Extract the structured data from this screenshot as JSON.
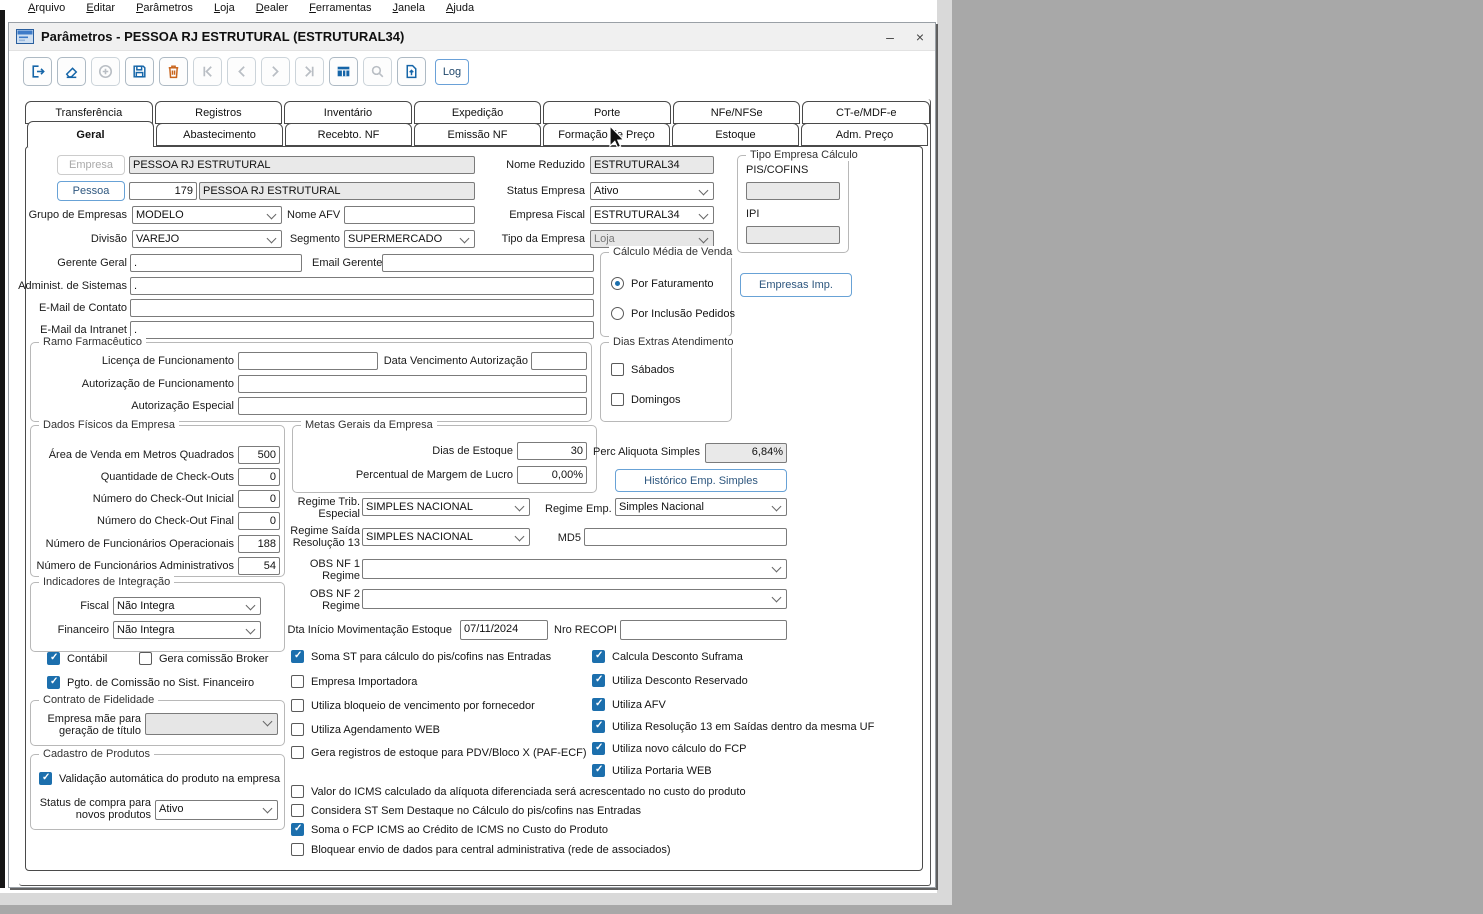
{
  "colors": {
    "accent_blue": "#1c6fad",
    "button_border_blue": "#68a2d6",
    "toolbar_icon_blue": "#1565a8",
    "trash_orange": "#c9651d",
    "desktop_gray": "#a8a8a8",
    "readonly_field_gray": "#e9e9e9"
  },
  "menu": {
    "items": [
      "Arquivo",
      "Editar",
      "Parâmetros",
      "Loja",
      "Dealer",
      "Ferramentas",
      "Janela",
      "Ajuda"
    ]
  },
  "window": {
    "title": "Parâmetros - PESSOA RJ ESTRUTURAL (ESTRUTURAL34)",
    "minimize": "–",
    "close": "×"
  },
  "toolbar": {
    "log": "Log"
  },
  "tabs": {
    "row1": [
      "Transferência",
      "Registros",
      "Inventário",
      "Expedição",
      "Porte",
      "NFe/NFSe",
      "CT-e/MDF-e"
    ],
    "row2": [
      "Geral",
      "Abastecimento",
      "Recebto. NF",
      "Emissão NF",
      "Formação de Preço",
      "Estoque",
      "Adm. Preço"
    ],
    "active": "Geral"
  },
  "form": {
    "empresa_btn": "Empresa",
    "empresa_value": "PESSOA RJ ESTRUTURAL",
    "nome_reduzido_label": "Nome Reduzido",
    "nome_reduzido_value": "ESTRUTURAL34",
    "pessoa_btn": "Pessoa",
    "pessoa_code": "179",
    "pessoa_value": "PESSOA RJ ESTRUTURAL",
    "status_label": "Status Empresa",
    "status_value": "Ativo",
    "grupo_label": "Grupo de Empresas",
    "grupo_value": "MODELO",
    "afv_label": "Nome AFV",
    "afv_value": "",
    "fiscal_label": "Empresa Fiscal",
    "fiscal_value": "ESTRUTURAL34",
    "divisao_label": "Divisão",
    "divisao_value": "VAREJO",
    "segmento_label": "Segmento",
    "segmento_value": "SUPERMERCADO",
    "tipo_label": "Tipo da Empresa",
    "tipo_value": "Loja",
    "calc_group": {
      "title": "Tipo Empresa Cálculo",
      "pis": "PIS/COFINS",
      "pis_value": "",
      "ipi": "IPI",
      "ipi_value": ""
    },
    "gerente_label": "Gerente Geral",
    "gerente_value": ".",
    "email_gerente_label": "Email Gerente",
    "email_gerente_value": "",
    "administ_label": "Administ. de Sistemas",
    "administ_value": ".",
    "email_contato_label": "E-Mail de Contato",
    "email_contato_value": "",
    "email_intranet_label": "E-Mail da Intranet",
    "email_intranet_value": ".",
    "media": {
      "title": "Cálculo Média de Venda",
      "opt1": "Por Faturamento",
      "opt1_selected": true,
      "opt2": "Por Inclusão Pedidos",
      "opt2_selected": false
    },
    "empresas_imp": "Empresas Imp.",
    "ramo": {
      "title": "Ramo Farmacêutico",
      "licenca": "Licença de Funcionamento",
      "licenca_value": "",
      "data_venc": "Data Vencimento Autorização",
      "data_venc_value": "",
      "aut_func": "Autorização de Funcionamento",
      "aut_func_value": "",
      "aut_esp": "Autorização Especial",
      "aut_esp_value": ""
    },
    "dias_extras": {
      "title": "Dias Extras Atendimento",
      "sabados": {
        "label": "Sábados",
        "checked": false
      },
      "domingos": {
        "label": "Domingos",
        "checked": false
      }
    },
    "fisicos": {
      "title": "Dados Físicos da Empresa",
      "rows": [
        {
          "label": "Área de Venda em Metros Quadrados",
          "value": "500"
        },
        {
          "label": "Quantidade de Check-Outs",
          "value": "0"
        },
        {
          "label": "Número do Check-Out Inicial",
          "value": "0"
        },
        {
          "label": "Número do Check-Out Final",
          "value": "0"
        },
        {
          "label": "Número de Funcionários Operacionais",
          "value": "188"
        },
        {
          "label": "Número de Funcionários Administrativos",
          "value": "54"
        }
      ]
    },
    "metas": {
      "title": "Metas Gerais da Empresa",
      "dias_label": "Dias de Estoque",
      "dias_value": "30",
      "margem_label": "Percentual de Margem de Lucro",
      "margem_value": "0,00%"
    },
    "aliquota_label": "Perc Aliquota Simples",
    "aliquota_value": "6,84%",
    "historico_btn": "Histórico Emp. Simples",
    "regime_trib_label": "Regime Trib.\nEspecial",
    "regime_trib_value": "SIMPLES NACIONAL",
    "regime_emp_label": "Regime Emp.",
    "regime_emp_value": "Simples Nacional",
    "regime_saida_label": "Regime Saída\nResolução 13",
    "regime_saida_value": "SIMPLES NACIONAL",
    "md5_label": "MD5",
    "md5_value": "",
    "obs1_label": "OBS NF 1\nRegime",
    "obs1_value": "",
    "obs2_label": "OBS NF 2\nRegime",
    "obs2_value": "",
    "dta_label": "Dta Início Movimentação Estoque",
    "dta_value": "07/11/2024",
    "recopi_label": "Nro RECOPI",
    "recopi_value": "",
    "integracao": {
      "title": "Indicadores de Integração",
      "fiscal_label": "Fiscal",
      "fiscal_value": "Não Integra",
      "financeiro_label": "Financeiro",
      "financeiro_value": "Não Integra"
    },
    "checks_left": [
      {
        "label": "Contábil",
        "checked": true
      },
      {
        "label": "Gera comissão Broker",
        "checked": false
      },
      {
        "label": "Pgto. de Comissão no Sist. Financeiro",
        "checked": true
      }
    ],
    "checks_mid": [
      {
        "label": "Soma ST para cálculo do pis/cofins nas Entradas",
        "checked": true
      },
      {
        "label": "Empresa Importadora",
        "checked": false
      },
      {
        "label": "Utiliza bloqueio de vencimento por fornecedor",
        "checked": false
      },
      {
        "label": "Utiliza Agendamento WEB",
        "checked": false
      },
      {
        "label": "Gera registros de estoque para PDV/Bloco X (PAF-ECF)",
        "checked": false
      }
    ],
    "checks_right": [
      {
        "label": "Calcula Desconto Suframa",
        "checked": true
      },
      {
        "label": "Utiliza Desconto Reservado",
        "checked": true
      },
      {
        "label": "Utiliza AFV",
        "checked": true
      },
      {
        "label": "Utiliza Resolução 13 em Saídas dentro da mesma UF",
        "checked": true
      },
      {
        "label": "Utiliza novo cálculo do FCP",
        "checked": true
      },
      {
        "label": "Utiliza Portaria WEB",
        "checked": true
      }
    ],
    "fidelidade": {
      "title": "Contrato de Fidelidade",
      "label": "Empresa mãe para\ngeração de título",
      "value": ""
    },
    "cadastro": {
      "title": "Cadastro de Produtos",
      "validacao": {
        "label": "Validação automática do produto na empresa",
        "checked": true
      },
      "status_label": "Status de compra para\nnovos produtos",
      "status_value": "Ativo"
    },
    "checks_bottom": [
      {
        "label": "Valor do ICMS calculado da alíquota diferenciada será acrescentado no custo do produto",
        "checked": false
      },
      {
        "label": "Considera ST Sem Destaque no Cálculo do pis/cofins nas Entradas",
        "checked": false
      },
      {
        "label": "Soma o FCP ICMS ao Crédito de ICMS no Custo do Produto",
        "checked": true
      },
      {
        "label": "Bloquear envio de dados para central administrativa (rede de associados)",
        "checked": false
      }
    ]
  }
}
